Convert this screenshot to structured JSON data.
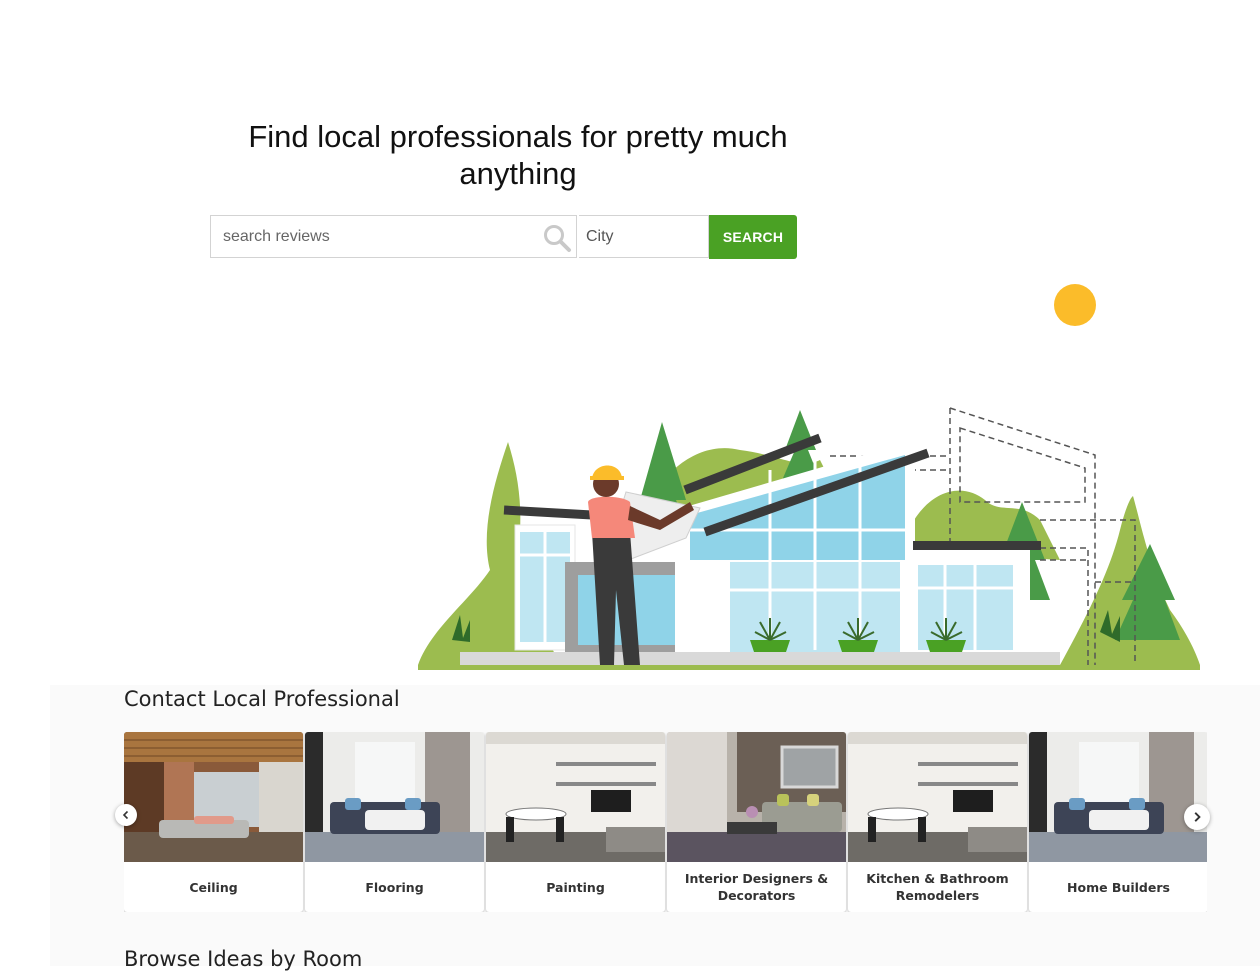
{
  "hero": {
    "title": "Find local professionals for pretty much anything"
  },
  "search": {
    "placeholder": "search reviews",
    "city_placeholder": "City",
    "button_label": "SEARCH"
  },
  "section_contact": {
    "title": "Contact Local Professional",
    "cards": [
      {
        "label": "Ceiling"
      },
      {
        "label": "Flooring"
      },
      {
        "label": "Painting"
      },
      {
        "label": "Interior Designers & Decorators"
      },
      {
        "label": "Kitchen & Bathroom Remodelers"
      },
      {
        "label": "Home Builders"
      }
    ]
  },
  "section_browse": {
    "title": "Browse Ideas by Room"
  },
  "colors": {
    "accent_green": "#4aa124",
    "sun_yellow": "#fbbc2a",
    "tree_green": "#4a9b48",
    "bush_green": "#9cbc4f"
  },
  "icons": {
    "search": "search-icon",
    "prev": "chevron-left-icon",
    "next": "chevron-right-icon"
  }
}
